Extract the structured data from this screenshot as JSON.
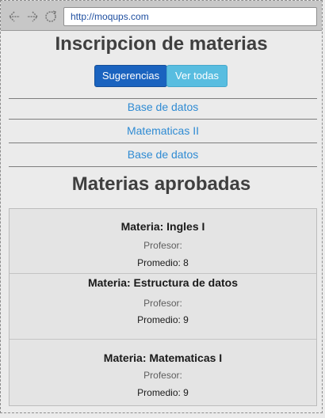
{
  "browser": {
    "url": "http://moqups.com",
    "icons": [
      "back-icon",
      "forward-icon",
      "refresh-icon"
    ]
  },
  "page": {
    "title": "Inscripcion de materias",
    "buttons": {
      "suggestions": "Sugerencias",
      "see_all": "Ver todas"
    },
    "links": [
      "Base de datos",
      "Matematicas II",
      "Base de datos"
    ],
    "approved_title": "Materias aprobadas",
    "approved": [
      {
        "name": "Materia: Ingles I",
        "teacher": "Profesor:",
        "average": "Promedio: 8"
      },
      {
        "name": "Materia: Estructura de datos",
        "teacher": "Profesor:",
        "average": "Promedio: 9"
      },
      {
        "name": "Materia: Matematicas I",
        "teacher": "Profesor:",
        "average": "Promedio: 9"
      }
    ]
  },
  "colors": {
    "primary": "#1a63bf",
    "secondary": "#58bde0",
    "link": "#2f8bd3"
  }
}
